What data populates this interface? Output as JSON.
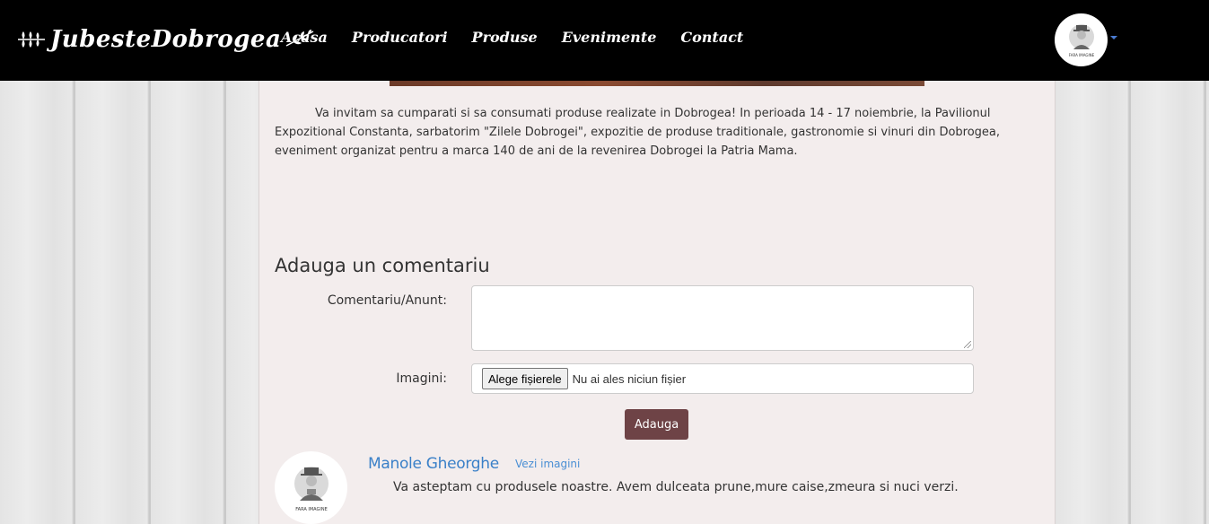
{
  "navbar": {
    "brand": "JubesteDobrogea",
    "links": [
      "Acasa",
      "Producatori",
      "Produse",
      "Evenimente",
      "Contact"
    ],
    "avatar_caption": "FARA IMAGINE"
  },
  "event": {
    "description": "Va invitam sa cumparati si sa consumati produse realizate in Dobrogea! In perioada 14 - 17 noiembrie, la Pavilionul Expozitional Constanta, sarbatorim \"Zilele Dobrogei\", expozitie de produse traditionale, gastronomie si vinuri din Dobrogea, eveniment organizat pentru a marca 140 de ani de la revenirea Dobrogei la Patria Mama."
  },
  "comment_form": {
    "title": "Adauga un comentariu",
    "comment_label": "Comentariu/Anunt:",
    "comment_value": "",
    "images_label": "Imagini:",
    "file_button": "Alege fișierele",
    "file_status": "Nu ai ales niciun fișier",
    "submit": "Adauga"
  },
  "comments": [
    {
      "author": "Manole Gheorghe",
      "view_images": "Vezi imagini",
      "text": "Va asteptam cu produsele noastre. Avem dulceata prune,mure caise,zmeura si nuci verzi.",
      "avatar_caption": "FARA IMAGINE"
    }
  ],
  "colors": {
    "navbar": "#000000",
    "panel": "#f3eded",
    "submit_button": "#6e4346",
    "author_link": "#3a80c8"
  }
}
